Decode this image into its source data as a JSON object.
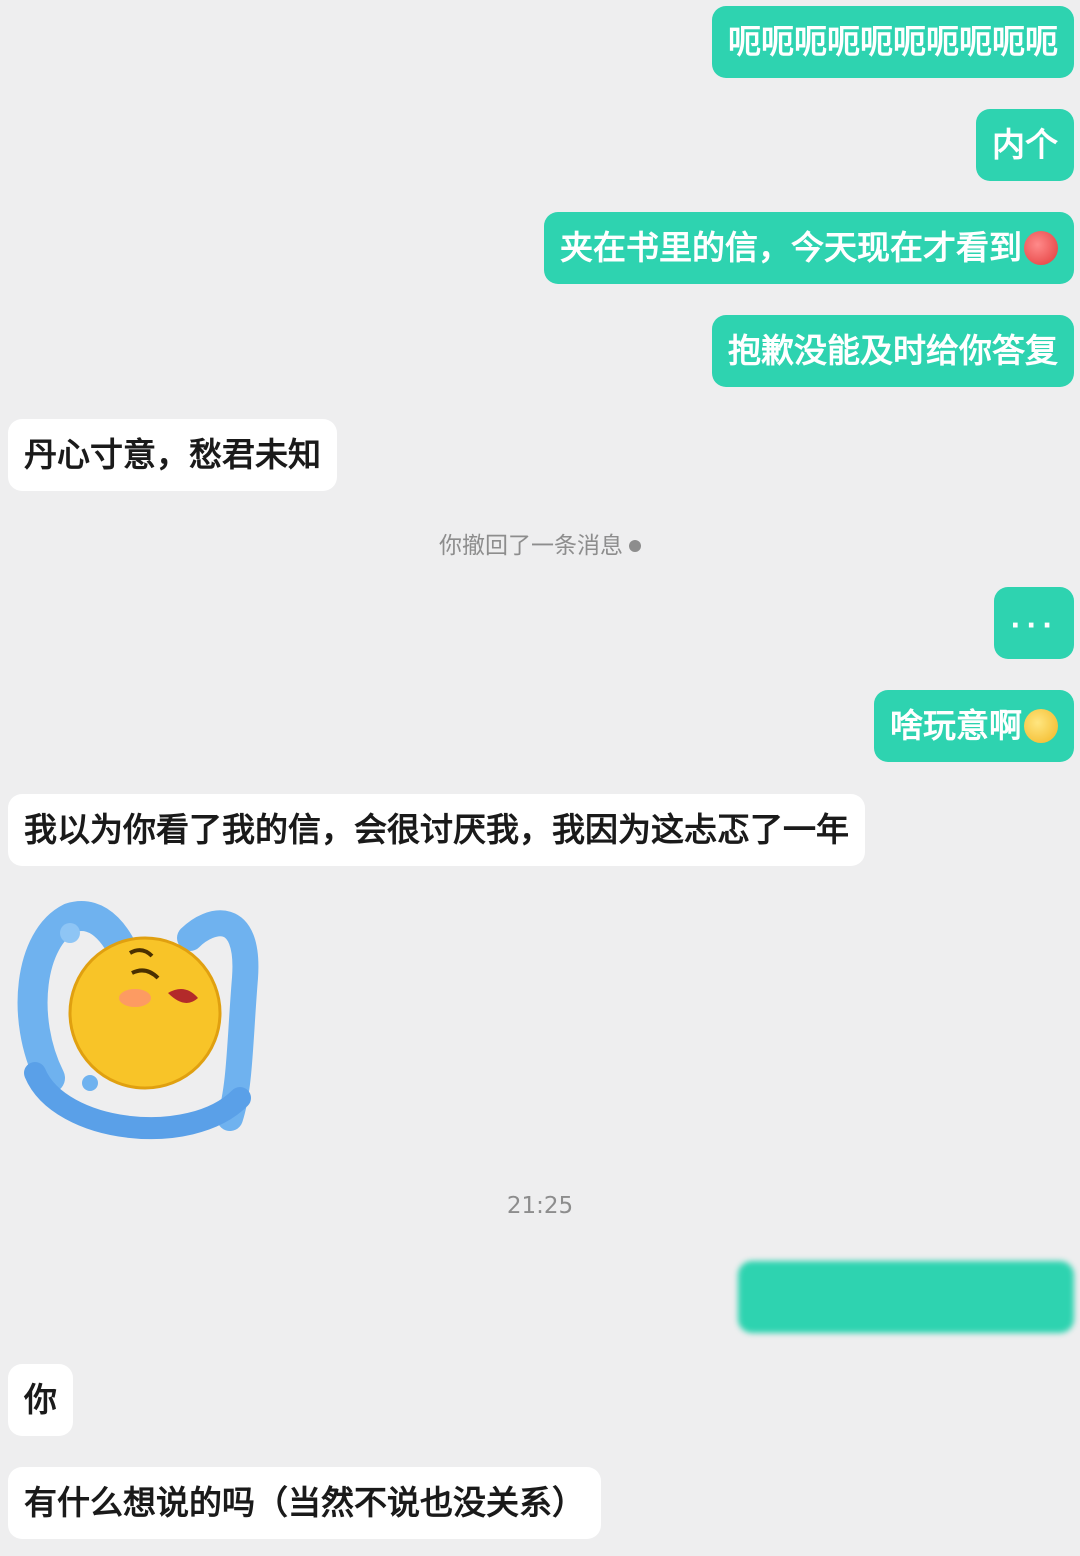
{
  "messages": {
    "m1": "呃呃呃呃呃呃呃呃呃呃",
    "m2": "内个",
    "m3": "夹在书里的信，今天现在才看到",
    "m4": "抱歉没能及时给你答复",
    "m5": "丹心寸意，愁君未知",
    "m6": "···",
    "m7": "啥玩意啊",
    "m8": "我以为你看了我的信，会很讨厌我，我因为这忐忑了一年",
    "m10": "你",
    "m11": "有什么想说的吗（当然不说也没关系）"
  },
  "system": {
    "withdrawn": "你撤回了一条消息",
    "time": "21:25"
  },
  "icons": {
    "m3_emoji": "flushed-face-emoji",
    "m7_emoji": "smirk-face-emoji",
    "sticker": "crying-face-sticker",
    "withdraw": "x-circle-icon"
  },
  "colors": {
    "outgoing_bubble": "#2ed3b0",
    "incoming_bubble": "#ffffff",
    "background": "#eeeeef"
  }
}
